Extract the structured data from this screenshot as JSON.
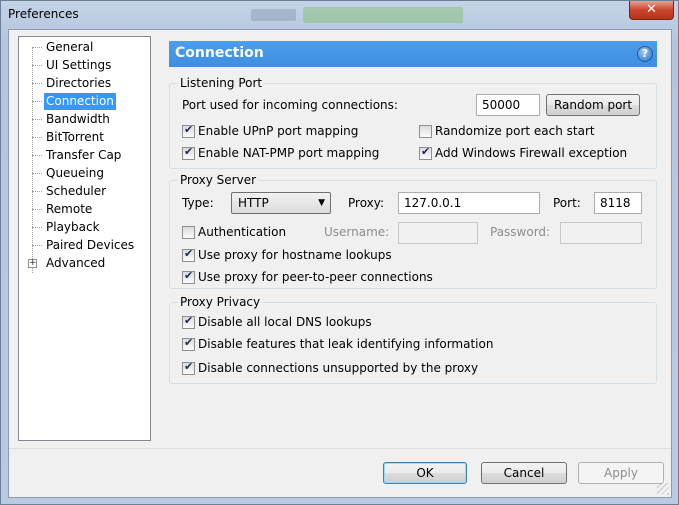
{
  "window": {
    "title": "Preferences",
    "close_glyph": "✕"
  },
  "sidebar": {
    "items": [
      {
        "label": "General"
      },
      {
        "label": "UI Settings"
      },
      {
        "label": "Directories"
      },
      {
        "label": "Connection",
        "selected": true
      },
      {
        "label": "Bandwidth"
      },
      {
        "label": "BitTorrent"
      },
      {
        "label": "Transfer Cap"
      },
      {
        "label": "Queueing"
      },
      {
        "label": "Scheduler"
      },
      {
        "label": "Remote"
      },
      {
        "label": "Playback"
      },
      {
        "label": "Paired Devices"
      },
      {
        "label": "Advanced",
        "expander": "+"
      }
    ]
  },
  "header": {
    "title": "Connection",
    "help_glyph": "?"
  },
  "listening_port": {
    "group_title": "Listening Port",
    "port_label": "Port used for incoming connections:",
    "port_value": "50000",
    "random_port_button": "Random port",
    "enable_upnp": {
      "label": "Enable UPnP port mapping",
      "checked": true
    },
    "randomize_port": {
      "label": "Randomize port each start",
      "checked": false
    },
    "enable_natpmp": {
      "label": "Enable NAT-PMP port mapping",
      "checked": true
    },
    "add_firewall": {
      "label": "Add Windows Firewall exception",
      "checked": true
    }
  },
  "proxy_server": {
    "group_title": "Proxy Server",
    "type_label": "Type:",
    "type_value": "HTTP",
    "proxy_label": "Proxy:",
    "proxy_value": "127.0.0.1",
    "port_label": "Port:",
    "port_value": "8118",
    "authentication": {
      "label": "Authentication",
      "checked": false
    },
    "username_label": "Username:",
    "password_label": "Password:",
    "hostname_lookups": {
      "label": "Use proxy for hostname lookups",
      "checked": true
    },
    "peer_connections": {
      "label": "Use proxy for peer-to-peer connections",
      "checked": true
    }
  },
  "proxy_privacy": {
    "group_title": "Proxy Privacy",
    "disable_dns": {
      "label": "Disable all local DNS lookups",
      "checked": true
    },
    "disable_leak": {
      "label": "Disable features that leak identifying information",
      "checked": true
    },
    "disable_unsupported": {
      "label": "Disable connections unsupported by the proxy",
      "checked": true
    }
  },
  "buttons": {
    "ok": "OK",
    "cancel": "Cancel",
    "apply": "Apply"
  }
}
